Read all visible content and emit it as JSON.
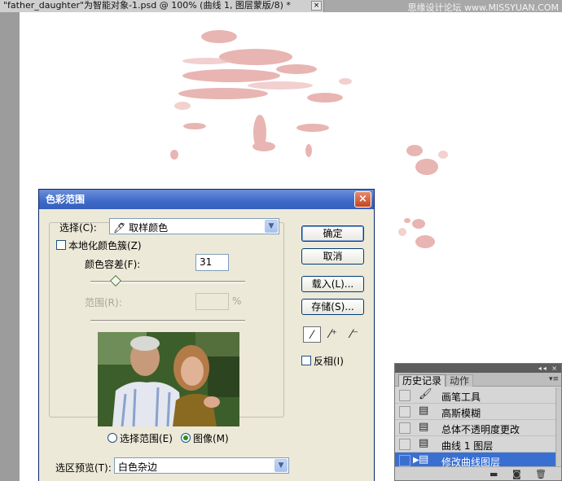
{
  "document": {
    "tab_title": "\"father_daughter\"为智能对象-1.psd @ 100% (曲线 1, 图层蒙版/8) *",
    "close_label": "×"
  },
  "watermark": "思缘设计论坛 www.MISSYUAN.COM",
  "dialog": {
    "title": "色彩范围",
    "close_label": "×",
    "select_label": "选择(C):",
    "select_value": "取样颜色",
    "localized_label": "本地化颜色簇(Z)",
    "localized_checked": false,
    "fuzziness_label": "颜色容差(F):",
    "fuzziness_value": "31",
    "range_label": "范围(R):",
    "range_value": "",
    "range_unit": "%",
    "radio_selection_label": "选择范围(E)",
    "radio_image_label": "图像(M)",
    "selected_view": "image",
    "preview_label": "选区预览(T):",
    "preview_value": "白色杂边",
    "buttons": {
      "ok": "确定",
      "cancel": "取消",
      "load": "载入(L)...",
      "save": "存储(S)..."
    },
    "invert_label": "反相(I)",
    "invert_checked": false,
    "icons": [
      "eyedropper-icon",
      "eyedropper-plus-icon",
      "eyedropper-minus-icon"
    ]
  },
  "history_panel": {
    "tabs": [
      "历史记录",
      "动作"
    ],
    "active_tab": "历史记录",
    "items": [
      {
        "label": "画笔工具",
        "icon": "brush-icon"
      },
      {
        "label": "高斯模糊",
        "icon": "history-state-icon"
      },
      {
        "label": "总体不透明度更改",
        "icon": "history-state-icon"
      },
      {
        "label": "曲线 1 图层",
        "icon": "history-state-icon"
      },
      {
        "label": "修改曲线图层",
        "icon": "history-state-icon",
        "selected": true
      }
    ]
  },
  "colors": {
    "dialog_bg": "#ece9d8",
    "title_bar": "#3e69c8",
    "selection_blue": "#3a6fd2",
    "mask_pink": "#e2a3a0"
  }
}
